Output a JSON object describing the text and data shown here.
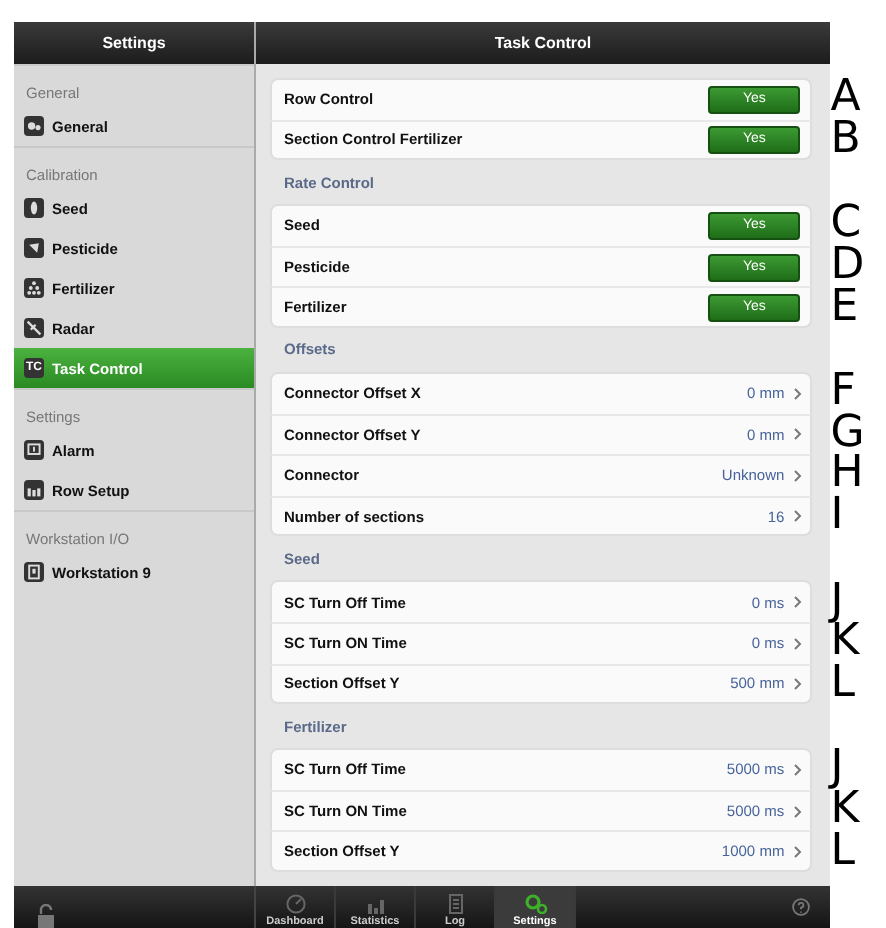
{
  "sidebar": {
    "title": "Settings",
    "sections": [
      {
        "label": "General",
        "items": [
          {
            "label": "General",
            "selected": false
          }
        ]
      },
      {
        "label": "Calibration",
        "items": [
          {
            "label": "Seed",
            "selected": false
          },
          {
            "label": "Pesticide",
            "selected": false
          },
          {
            "label": "Fertilizer",
            "selected": false
          },
          {
            "label": "Radar",
            "selected": false
          },
          {
            "label": "Task Control",
            "icon_text": "TC",
            "selected": true
          }
        ]
      },
      {
        "label": "Settings",
        "items": [
          {
            "label": "Alarm",
            "selected": false
          },
          {
            "label": "Row Setup",
            "selected": false
          }
        ]
      },
      {
        "label": "Workstation I/O",
        "items": [
          {
            "label": "Workstation 9",
            "selected": false
          }
        ]
      }
    ]
  },
  "main": {
    "title": "Task Control",
    "groups": [
      {
        "rows": [
          {
            "label": "Row Control",
            "kind": "toggle",
            "value": "Yes",
            "marker": "A"
          },
          {
            "label": "Section Control Fertilizer",
            "kind": "toggle",
            "value": "Yes",
            "marker": "B"
          }
        ]
      },
      {
        "title": "Rate Control",
        "rows": [
          {
            "label": "Seed",
            "kind": "toggle",
            "value": "Yes",
            "marker": "C"
          },
          {
            "label": "Pesticide",
            "kind": "toggle",
            "value": "Yes",
            "marker": "D"
          },
          {
            "label": "Fertilizer",
            "kind": "toggle",
            "value": "Yes",
            "marker": "E"
          }
        ]
      },
      {
        "title": "Offsets",
        "rows": [
          {
            "label": "Connector Offset X",
            "kind": "value",
            "value": "0 mm",
            "marker": "F"
          },
          {
            "label": "Connector Offset Y",
            "kind": "value",
            "value": "0 mm",
            "marker": "G"
          },
          {
            "label": "Connector",
            "kind": "value",
            "value": "Unknown",
            "marker": "H"
          },
          {
            "label": "Number of sections",
            "kind": "value",
            "value": "16",
            "marker": "I"
          }
        ]
      },
      {
        "title": "Seed",
        "rows": [
          {
            "label": "SC Turn Off Time",
            "kind": "value",
            "value": "0 ms",
            "marker": "J"
          },
          {
            "label": "SC Turn ON Time",
            "kind": "value",
            "value": "0 ms",
            "marker": "K"
          },
          {
            "label": "Section Offset Y",
            "kind": "value",
            "value": "500 mm",
            "marker": "L"
          }
        ]
      },
      {
        "title": "Fertilizer",
        "rows": [
          {
            "label": "SC Turn Off Time",
            "kind": "value",
            "value": "5000 ms",
            "marker": "J"
          },
          {
            "label": "SC Turn ON Time",
            "kind": "value",
            "value": "5000 ms",
            "marker": "K"
          },
          {
            "label": "Section Offset Y",
            "kind": "value",
            "value": "1000 mm",
            "marker": "L"
          }
        ]
      }
    ]
  },
  "tabbar": {
    "tabs": [
      {
        "label": "Dashboard",
        "selected": false
      },
      {
        "label": "Statistics",
        "selected": false
      },
      {
        "label": "Log",
        "selected": false
      },
      {
        "label": "Settings",
        "selected": true
      }
    ]
  }
}
